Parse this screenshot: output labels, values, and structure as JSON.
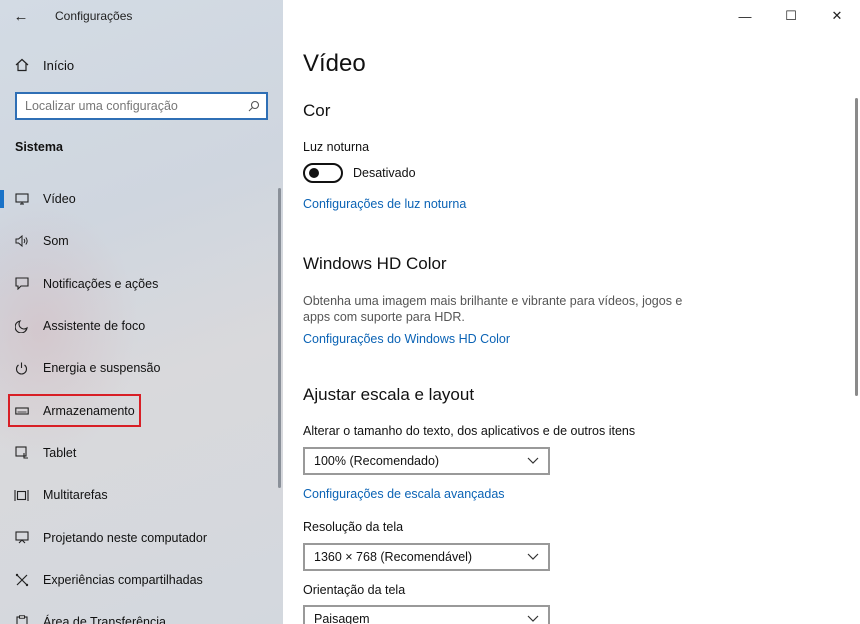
{
  "app": {
    "title": "Configurações",
    "back_glyph": "←"
  },
  "sidebar": {
    "home_label": "Início",
    "search_placeholder": "Localizar uma configuração",
    "section_label": "Sistema",
    "items": [
      {
        "label": "Vídeo",
        "icon": "monitor-icon",
        "active": true
      },
      {
        "label": "Som",
        "icon": "speaker-icon"
      },
      {
        "label": "Notificações e ações",
        "icon": "notification-icon"
      },
      {
        "label": "Assistente de foco",
        "icon": "moon-icon"
      },
      {
        "label": "Energia e suspensão",
        "icon": "power-icon"
      },
      {
        "label": "Armazenamento",
        "icon": "storage-icon",
        "highlighted": true
      },
      {
        "label": "Tablet",
        "icon": "tablet-icon"
      },
      {
        "label": "Multitarefas",
        "icon": "multitask-icon"
      },
      {
        "label": "Projetando neste computador",
        "icon": "projector-icon"
      },
      {
        "label": "Experiências compartilhadas",
        "icon": "shared-icon"
      },
      {
        "label": "Área de Transferência",
        "icon": "clipboard-icon"
      }
    ]
  },
  "window": {
    "minimize": "—",
    "maximize": "☐",
    "close": "✕"
  },
  "main": {
    "page_title": "Vídeo",
    "color_section": {
      "heading": "Cor",
      "night_light_label": "Luz noturna",
      "night_light_state": "Desativado",
      "night_light_link": "Configurações de luz noturna"
    },
    "hd_section": {
      "heading": "Windows HD Color",
      "description": "Obtenha uma imagem mais brilhante e vibrante para vídeos, jogos e apps com suporte para HDR.",
      "link": "Configurações do Windows HD Color"
    },
    "scale_section": {
      "heading": "Ajustar escala e layout",
      "scale_label": "Alterar o tamanho do texto, dos aplicativos e de outros itens",
      "scale_value": "100% (Recomendado)",
      "advanced_link": "Configurações de escala avançadas",
      "resolution_label": "Resolução da tela",
      "resolution_value": "1360 × 768 (Recomendável)",
      "orientation_label": "Orientação da tela",
      "orientation_value": "Paisagem"
    }
  },
  "colors": {
    "accent": "#1a73c8",
    "link": "#0b63b5",
    "highlight_box": "#d81f26"
  }
}
